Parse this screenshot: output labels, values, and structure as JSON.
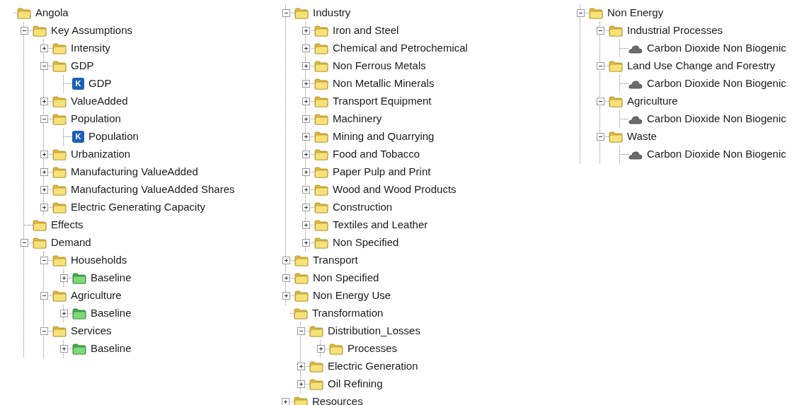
{
  "columns": [
    {
      "nodes": [
        {
          "label": "Angola",
          "kind": "folder",
          "children": [
            {
              "label": "Key Assumptions",
              "kind": "folder",
              "expanded": true,
              "children": [
                {
                  "label": "Intensity",
                  "kind": "folder",
                  "expanded": false
                },
                {
                  "label": "GDP",
                  "kind": "folder",
                  "expanded": true,
                  "children": [
                    {
                      "label": "GDP",
                      "kind": "key",
                      "badge": "K"
                    }
                  ]
                },
                {
                  "label": "ValueAdded",
                  "kind": "folder",
                  "expanded": false
                },
                {
                  "label": "Population",
                  "kind": "folder",
                  "expanded": true,
                  "children": [
                    {
                      "label": "Population",
                      "kind": "key",
                      "badge": "K"
                    }
                  ]
                },
                {
                  "label": "Urbanization",
                  "kind": "folder",
                  "expanded": false
                },
                {
                  "label": "Manufacturing ValueAdded",
                  "kind": "folder",
                  "expanded": false
                },
                {
                  "label": "Manufacturing ValueAdded Shares",
                  "kind": "folder",
                  "expanded": false
                },
                {
                  "label": "Electric Generating Capacity",
                  "kind": "folder",
                  "expanded": false
                }
              ]
            },
            {
              "label": "Effects",
              "kind": "folder"
            },
            {
              "label": "Demand",
              "kind": "folder",
              "expanded": true,
              "children": [
                {
                  "label": "Households",
                  "kind": "folder",
                  "expanded": true,
                  "children": [
                    {
                      "label": "Baseline",
                      "kind": "scenario",
                      "expanded": false
                    }
                  ]
                },
                {
                  "label": "Agriculture",
                  "kind": "folder",
                  "expanded": true,
                  "children": [
                    {
                      "label": "Baseline",
                      "kind": "scenario",
                      "expanded": false
                    }
                  ]
                },
                {
                  "label": "Services",
                  "kind": "folder",
                  "expanded": true,
                  "children": [
                    {
                      "label": "Baseline",
                      "kind": "scenario",
                      "expanded": false
                    }
                  ]
                }
              ]
            }
          ]
        }
      ]
    },
    {
      "continued_nodes": [
        {
          "label": "Industry",
          "kind": "folder",
          "expanded": true,
          "children": [
            {
              "label": "Iron and Steel",
              "kind": "folder",
              "expanded": false
            },
            {
              "label": "Chemical and Petrochemical",
              "kind": "folder",
              "expanded": false
            },
            {
              "label": "Non Ferrous Metals",
              "kind": "folder",
              "expanded": false
            },
            {
              "label": "Non Metallic Minerals",
              "kind": "folder",
              "expanded": false
            },
            {
              "label": "Transport Equipment",
              "kind": "folder",
              "expanded": false
            },
            {
              "label": "Machinery",
              "kind": "folder",
              "expanded": false
            },
            {
              "label": "Mining and Quarrying",
              "kind": "folder",
              "expanded": false
            },
            {
              "label": "Food and Tobacco",
              "kind": "folder",
              "expanded": false
            },
            {
              "label": "Paper Pulp and Print",
              "kind": "folder",
              "expanded": false
            },
            {
              "label": "Wood and Wood Products",
              "kind": "folder",
              "expanded": false
            },
            {
              "label": "Construction",
              "kind": "folder",
              "expanded": false
            },
            {
              "label": "Textiles and Leather",
              "kind": "folder",
              "expanded": false
            },
            {
              "label": "Non Specified",
              "kind": "folder",
              "expanded": false
            }
          ]
        },
        {
          "label": "Transport",
          "kind": "folder",
          "expanded": false
        },
        {
          "label": "Non Specified",
          "kind": "folder",
          "expanded": false
        },
        {
          "label": "Non Energy Use",
          "kind": "folder",
          "expanded": false
        }
      ],
      "nodes": [
        {
          "label": "Transformation",
          "kind": "folder",
          "children": [
            {
              "label": "Distribution_Losses",
              "kind": "folder",
              "expanded": true,
              "children": [
                {
                  "label": "Processes",
                  "kind": "folder",
                  "expanded": false
                }
              ]
            },
            {
              "label": "Electric Generation",
              "kind": "folder",
              "expanded": false
            },
            {
              "label": "Oil Refining",
              "kind": "folder",
              "expanded": false
            }
          ]
        },
        {
          "label": "Resources",
          "kind": "folder",
          "expanded": false
        }
      ]
    },
    {
      "continued_nodes": [
        {
          "label": "Non Energy",
          "kind": "folder",
          "expanded": true,
          "children": [
            {
              "label": "Industrial Processes",
              "kind": "folder",
              "expanded": true,
              "children": [
                {
                  "label": "Carbon Dioxide Non Biogenic",
                  "kind": "effect"
                }
              ]
            },
            {
              "label": "Land Use Change and Forestry",
              "kind": "folder",
              "expanded": true,
              "children": [
                {
                  "label": "Carbon Dioxide Non Biogenic",
                  "kind": "effect"
                }
              ]
            },
            {
              "label": "Agriculture",
              "kind": "folder",
              "expanded": true,
              "children": [
                {
                  "label": "Carbon Dioxide Non Biogenic",
                  "kind": "effect"
                }
              ]
            },
            {
              "label": "Waste",
              "kind": "folder",
              "expanded": true,
              "children": [
                {
                  "label": "Carbon Dioxide Non Biogenic",
                  "kind": "effect"
                }
              ]
            }
          ]
        }
      ]
    }
  ]
}
